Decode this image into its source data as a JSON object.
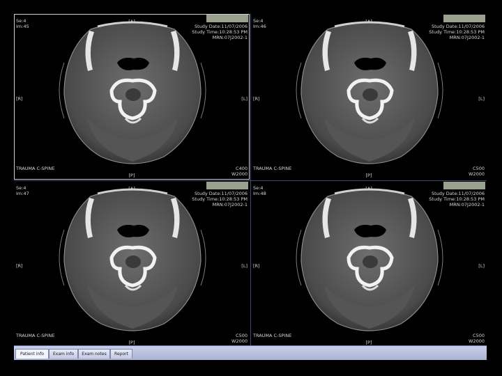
{
  "viewports": [
    {
      "series": "Se:4",
      "image": "Im:45",
      "study_date": "Study Date:11/07/2006",
      "study_time": "Study Time:10:28:53 PM",
      "mrn": "MRN:07J2002-1",
      "orient_top": "[A]",
      "orient_bottom": "[P]",
      "orient_left": "[R]",
      "orient_right": "[L]",
      "protocol": "TRAUMA C-SPINE",
      "window_center": "C400",
      "window_width": "W2000"
    },
    {
      "series": "Se:4",
      "image": "Im:46",
      "study_date": "Study Date:11/07/2006",
      "study_time": "Study Time:10:28:53 PM",
      "mrn": "MRN:07J2002-1",
      "orient_top": "[A]",
      "orient_bottom": "[P]",
      "orient_left": "[R]",
      "orient_right": "[L]",
      "protocol": "TRAUMA C-SPINE",
      "window_center": "C500",
      "window_width": "W2000"
    },
    {
      "series": "Se:4",
      "image": "Im:47",
      "study_date": "Study Date:11/07/2006",
      "study_time": "Study Time:10:28:53 PM",
      "mrn": "MRN:07J2002-1",
      "orient_top": "[A]",
      "orient_bottom": "[P]",
      "orient_left": "[R]",
      "orient_right": "[L]",
      "protocol": "TRAUMA C-SPINE",
      "window_center": "C500",
      "window_width": "W2000"
    },
    {
      "series": "Se:4",
      "image": "Im:48",
      "study_date": "Study Date:11/07/2006",
      "study_time": "Study Time:10:28:53 PM",
      "mrn": "MRN:07J2002-1",
      "orient_top": "[A]",
      "orient_bottom": "[P]",
      "orient_left": "[R]",
      "orient_right": "[L]",
      "protocol": "TRAUMA C-SPINE",
      "window_center": "C500",
      "window_width": "W2000"
    }
  ],
  "tabs": [
    {
      "label": "Patient info"
    },
    {
      "label": "Exam info"
    },
    {
      "label": "Exam notes"
    },
    {
      "label": "Report"
    }
  ],
  "active_tab": "Patient info",
  "colors": {
    "background": "#000000",
    "tabbar": "#aab3d4",
    "divider": "#3c4a78"
  }
}
